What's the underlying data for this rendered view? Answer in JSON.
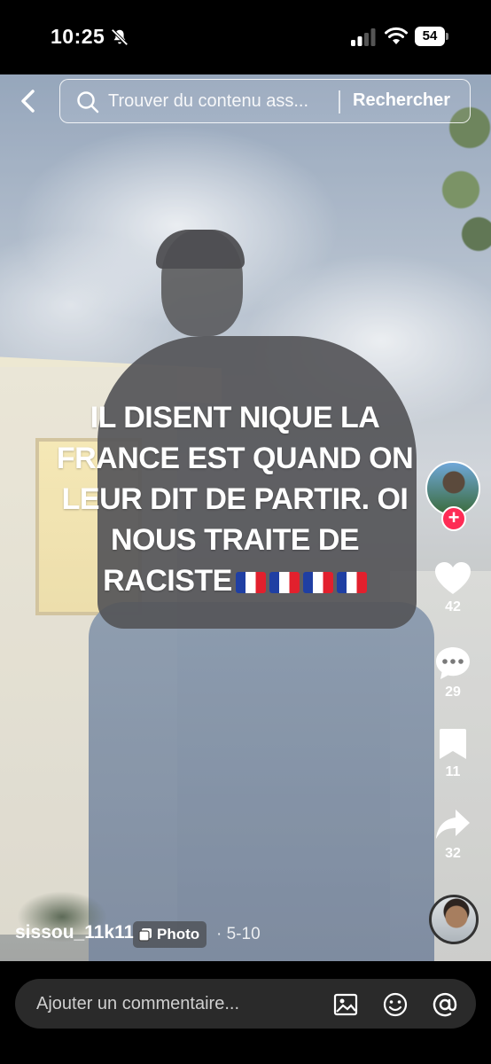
{
  "status_bar": {
    "time": "10:25",
    "battery": "54",
    "icons": [
      "bell-off-icon",
      "signal-icon",
      "wifi-icon",
      "battery-icon"
    ]
  },
  "search": {
    "placeholder": "Trouver du contenu ass...",
    "button_label": "Rechercher"
  },
  "post": {
    "caption_lines": [
      "IL DISENT NIQUE LA",
      "FRANCE EST QUAND ON",
      "LEUR DIT DE PARTIR. OI",
      "NOUS TRAITE DE",
      "RACISTE"
    ],
    "caption_flags": [
      "🇫🇷",
      "🇫🇷",
      "🇫🇷",
      "🇫🇷"
    ],
    "username": "sissou_11k11",
    "type_badge": "Photo",
    "date": "· 5-10"
  },
  "actions": {
    "follow_symbol": "+",
    "likes": "42",
    "comments": "29",
    "saves": "11",
    "shares": "32"
  },
  "comment_bar": {
    "placeholder": "Ajouter un commentaire...",
    "icons": [
      "image-icon",
      "emoji-icon",
      "mention-icon"
    ]
  },
  "colors": {
    "follow_red": "#fe2c55",
    "flag_blue": "#1f3fa3",
    "flag_red": "#e2202d"
  }
}
